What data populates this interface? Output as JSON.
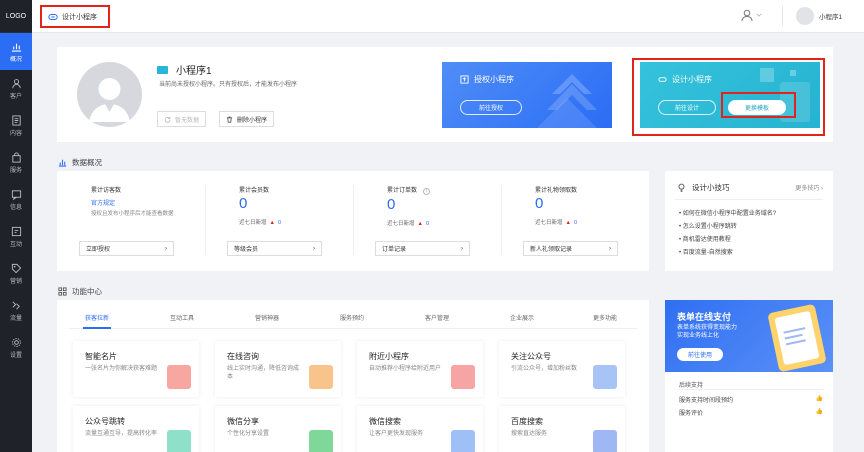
{
  "sidebar": {
    "logo": "LOGO",
    "items": [
      {
        "label": "概况",
        "icon": "chart-icon",
        "active": true
      },
      {
        "label": "客户",
        "icon": "person-icon",
        "active": false
      },
      {
        "label": "内容",
        "icon": "document-icon",
        "active": false
      },
      {
        "label": "服务",
        "icon": "bag-icon",
        "active": false
      },
      {
        "label": "信息",
        "icon": "message-icon",
        "active": false
      },
      {
        "label": "互动",
        "icon": "interaction-icon",
        "active": false
      },
      {
        "label": "营销",
        "icon": "tag-icon",
        "active": false
      },
      {
        "label": "流量",
        "icon": "flow-icon",
        "active": false
      },
      {
        "label": "设置",
        "icon": "gear-icon",
        "active": false
      }
    ]
  },
  "header": {
    "design_tab_label": "设计小程序",
    "user_name": "小程序1"
  },
  "profile": {
    "name": "小程序1",
    "desc": "当前尚未授权小程序。只有授权后，才能发布小程序",
    "pause_btn": "暂无数据",
    "delete_btn": "删除小程序"
  },
  "auth_banner": {
    "title": "授权小程序",
    "button": "前往授权"
  },
  "design_banner": {
    "title": "设计小程序",
    "design_btn": "前往设计",
    "change_btn": "更换模板"
  },
  "data_overview": {
    "title": "数据概况",
    "stats": [
      {
        "label": "累计访客数",
        "value": "",
        "link": "官方规定",
        "note": "授权且发布小程序后才能查看数据",
        "button": "立即授权"
      },
      {
        "label": "累计会员数",
        "value": "0",
        "sub": "近七日新增",
        "delta": "0",
        "button": "等级会员"
      },
      {
        "label": "累计订单数",
        "value": "0",
        "sub": "近七日新增",
        "delta": "0",
        "button": "订单记录"
      },
      {
        "label": "累计礼物领取数",
        "value": "0",
        "sub": "近七日新增",
        "delta": "0",
        "button": "新人礼领取记录"
      }
    ]
  },
  "tips": {
    "title": "设计小技巧",
    "more": "更多技巧",
    "items": [
      "如何在微信小程序中配置业务域名?",
      "怎么设置小程序跳转",
      "商机雷达使用教程",
      "百度流量-自然搜索"
    ]
  },
  "function_center": {
    "title": "功能中心",
    "tabs": [
      "获客拉新",
      "互动工具",
      "营销神器",
      "服务预约",
      "客户管理",
      "企业展示",
      "更多功能"
    ],
    "cards": [
      {
        "title": "智能名片",
        "desc": "一张名片为你解决获客难题",
        "art_color": "#f7a6a0"
      },
      {
        "title": "在线咨询",
        "desc": "线上实时沟通，降低咨询成本",
        "art_color": "#f8c48b"
      },
      {
        "title": "附近小程序",
        "desc": "自动推荐小程序给附近用户",
        "art_color": "#f6a4a4"
      },
      {
        "title": "关注公众号",
        "desc": "引流公众号，增加粉丝数",
        "art_color": "#a8c4f6"
      },
      {
        "title": "公众号跳转",
        "desc": "流量互通互导，提高转化率",
        "art_color": "#8fe0c8"
      },
      {
        "title": "微信分享",
        "desc": "个性化分享设置",
        "art_color": "#7fd89a"
      },
      {
        "title": "微信搜索",
        "desc": "让客户更快发现服务",
        "art_color": "#9ec0f6"
      },
      {
        "title": "百度搜索",
        "desc": "搜索直达服务",
        "art_color": "#9fb8f4"
      }
    ]
  },
  "promo": {
    "title": "表单在线支付",
    "sub_line1": "表单系统获得变现能力",
    "sub_line2": "实现业务线上化",
    "button": "前往使用",
    "section": "后续支持",
    "items": [
      "服务支持时间段预约",
      "服务评价"
    ]
  },
  "colors": {
    "primary": "#2b6df5",
    "sidebar_bg": "#1f2229",
    "highlight_red": "#e2231a",
    "teal": "#35c2dc"
  }
}
